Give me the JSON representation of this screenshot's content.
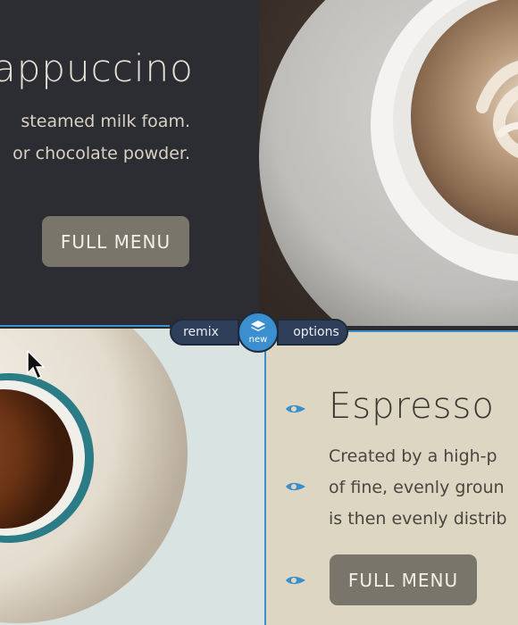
{
  "top_card": {
    "title": "appuccino",
    "description_lines": [
      "steamed milk foam.",
      "or chocolate powder."
    ],
    "button_label": "FULL MENU"
  },
  "bottom_card": {
    "title": "Espresso",
    "description_lines": [
      "Created by a high-p",
      "of fine, evenly groun",
      "is then evenly distrib"
    ],
    "button_label": "FULL MENU"
  },
  "toolbar": {
    "remix_label": "remix",
    "new_label": "new",
    "options_label": "options"
  },
  "colors": {
    "dark_panel": "#2c2d32",
    "beige_panel": "#ddd6c3",
    "button": "#79756b",
    "accent_blue": "#3a8fcb",
    "toolbar_bg": "#2f3f5a"
  },
  "icons": [
    "layers-icon",
    "drag-handle-icon",
    "mouse-pointer-icon"
  ]
}
